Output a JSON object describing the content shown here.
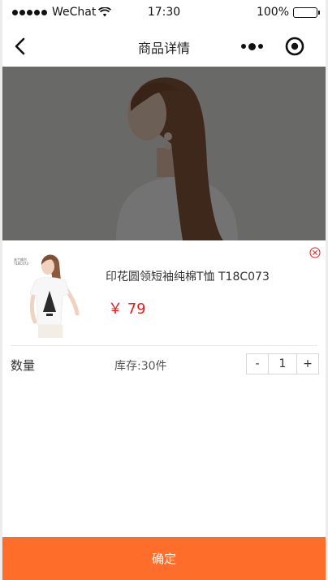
{
  "status_bar": {
    "carrier": "WeChat",
    "time": "17:30",
    "battery": "100%",
    "battery_level": 1.0
  },
  "nav": {
    "title": "商品详情"
  },
  "product": {
    "name": "印花圆领短袖纯棉T恤 T18C073",
    "price": "￥ 79",
    "thumb_tag": "米兰维尔\nT18C073"
  },
  "quantity": {
    "label": "数量",
    "stock": "库存:30件",
    "minus": "-",
    "value": "1",
    "plus": "+"
  },
  "footer": {
    "confirm_label": "确定"
  },
  "colors": {
    "accent": "#ff6d2b",
    "price": "#e02020"
  }
}
